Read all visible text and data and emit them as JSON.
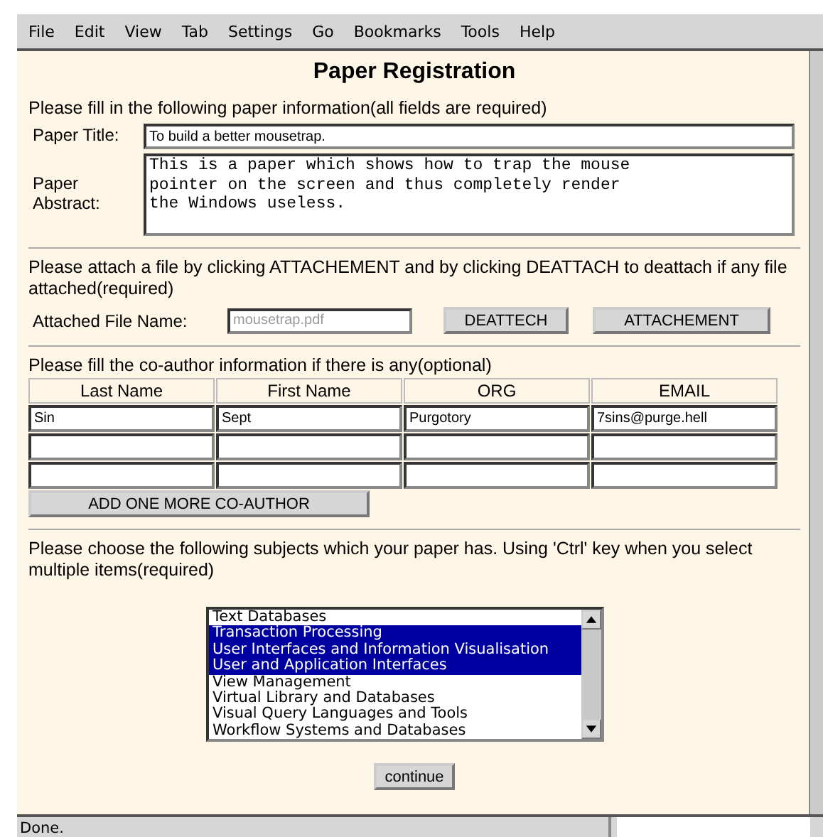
{
  "menu": [
    "File",
    "Edit",
    "View",
    "Tab",
    "Settings",
    "Go",
    "Bookmarks",
    "Tools",
    "Help"
  ],
  "title": "Paper Registration",
  "paper_section": {
    "intro": "Please fill in the following paper information(all fields are required)",
    "title_label": "Paper Title:",
    "title_value": "To build a better mousetrap.",
    "abstract_label": "Paper Abstract:",
    "abstract_value": "This is a paper which shows how to trap the mouse\npointer on the screen and thus completely render\nthe Windows useless."
  },
  "attach_section": {
    "intro": "Please attach a file by clicking ATTACHEMENT and by clicking DEATTACH to deattach if any file attached(required)",
    "file_label": "Attached File Name:",
    "file_value": "mousetrap.pdf",
    "file_disabled": true,
    "buttons": [
      "DEATTECH",
      "ATTACHEMENT"
    ]
  },
  "coauthor_section": {
    "intro": "Please fill the co-author information if there is any(optional)",
    "columns": [
      "Last Name",
      "First Name",
      "ORG",
      "EMAIL"
    ],
    "rows": [
      [
        "Sin",
        "Sept",
        "Purgotory",
        "7sins@purge.hell"
      ],
      [
        "",
        "",
        "",
        ""
      ],
      [
        "",
        "",
        "",
        ""
      ]
    ],
    "add_button": "ADD ONE MORE CO-AUTHOR"
  },
  "subject_section": {
    "intro": "Please choose the following subjects which your paper has. Using 'Ctrl' key when you select multiple items(required)",
    "subjects": [
      {
        "label": "Text Databases",
        "selected": false
      },
      {
        "label": "Transaction Processing",
        "selected": true
      },
      {
        "label": "User Interfaces and Information Visualisation",
        "selected": true
      },
      {
        "label": "User and Application Interfaces",
        "selected": true
      },
      {
        "label": "View Management",
        "selected": false
      },
      {
        "label": "Virtual Library and Databases",
        "selected": false
      },
      {
        "label": "Visual Query Languages and Tools",
        "selected": false
      },
      {
        "label": "Workflow Systems and Databases",
        "selected": false
      }
    ]
  },
  "continue_button": "continue",
  "status_bar": "Done."
}
